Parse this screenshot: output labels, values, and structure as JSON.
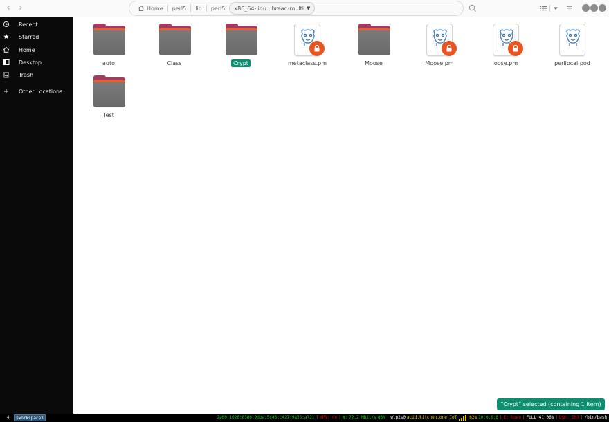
{
  "header": {
    "back_icon": "chevron-left-icon",
    "forward_icon": "chevron-right-icon",
    "breadcrumbs": [
      {
        "label": "Home",
        "icon": "home-icon"
      },
      {
        "label": "perl5"
      },
      {
        "label": "lib"
      },
      {
        "label": "perl5"
      }
    ],
    "current_crumb": "x86_64-linu...hread-multi",
    "search_icon": "search-icon",
    "view_icon": "list-view-icon",
    "sort_icon": "sort-dropdown-icon",
    "menu_icon": "hamburger-menu-icon"
  },
  "sidebar": {
    "items": [
      {
        "label": "Recent",
        "icon": "recent-clock-icon"
      },
      {
        "label": "Starred",
        "icon": "star-icon"
      },
      {
        "label": "Home",
        "icon": "home-icon"
      },
      {
        "label": "Desktop",
        "icon": "desktop-icon"
      },
      {
        "label": "Trash",
        "icon": "trash-icon"
      },
      {
        "label": "Other Locations",
        "icon": "plus-icon"
      }
    ]
  },
  "files": [
    {
      "name": "auto",
      "type": "folder",
      "selected": false
    },
    {
      "name": "Class",
      "type": "folder",
      "selected": false
    },
    {
      "name": "Crypt",
      "type": "folder",
      "selected": true
    },
    {
      "name": "metaclass.pm",
      "type": "perl-file",
      "locked": true
    },
    {
      "name": "Moose",
      "type": "folder",
      "selected": false
    },
    {
      "name": "Moose.pm",
      "type": "perl-file",
      "locked": true
    },
    {
      "name": "oose.pm",
      "type": "perl-file",
      "locked": true
    },
    {
      "name": "perllocal.pod",
      "type": "perl-file",
      "locked": false
    },
    {
      "name": "Test",
      "type": "folder",
      "selected": false
    }
  ],
  "toast": {
    "text": "“Crypt” selected (containing 1 item)"
  },
  "statusbar": {
    "workspace_number": "4",
    "workspace_name": "$workspace3",
    "ipv6": "2a00:1028:8386:9dba:5c48:c427:9a55:a721",
    "vpn": "VPN: no",
    "wireless_prefix": "W:",
    "speed": "72.2 MBit/s",
    "signal": "86%",
    "iface": "wlp2s0",
    "ssid": "acid.kitchen.one IoT",
    "battery_pct": "62%",
    "ipv4": "10.0.0.8",
    "ethernet": "E: down",
    "battery_full": "FULL 41.06%",
    "disk": "DSK: 103",
    "shell": "/bin/bash",
    "colors": {
      "green": "#00d000",
      "red": "#e00000",
      "yellow": "#e8d000",
      "white": "#ffffff"
    }
  },
  "colors": {
    "accent": "#0d8f6f",
    "folder_red": "#a63a5c",
    "folder_orange": "#e2622d",
    "lock_orange": "#e95420",
    "sidebar_bg": "#0a0a0a"
  }
}
